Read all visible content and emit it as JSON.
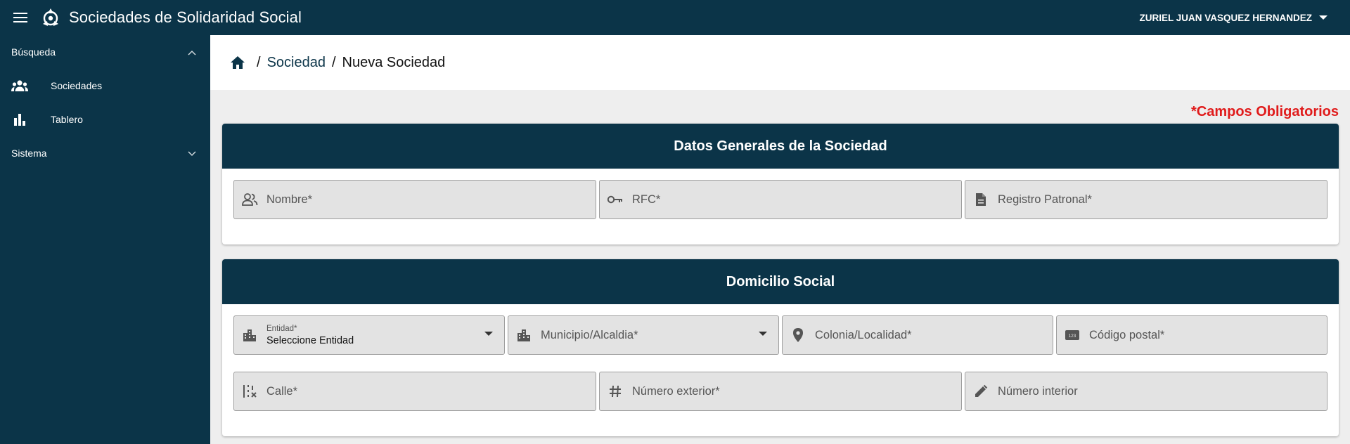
{
  "app": {
    "title": "Sociedades de Solidaridad Social"
  },
  "user": {
    "name": "ZURIEL JUAN VASQUEZ HERNANDEZ"
  },
  "sidebar": {
    "groups": [
      {
        "label": "Búsqueda",
        "expanded": true
      },
      {
        "label": "Sistema",
        "expanded": false
      }
    ],
    "items": [
      {
        "label": "Sociedades",
        "icon": "groups-icon"
      },
      {
        "label": "Tablero",
        "icon": "bar-chart-icon"
      }
    ]
  },
  "breadcrumb": {
    "link": "Sociedad",
    "current": "Nueva Sociedad",
    "separator": "/"
  },
  "required_note": "*Campos Obligatorios",
  "card_general": {
    "title": "Datos Generales de la Sociedad",
    "fields": [
      {
        "placeholder": "Nombre*",
        "icon": "people-outline-icon"
      },
      {
        "placeholder": "RFC*",
        "icon": "key-icon"
      },
      {
        "placeholder": "Registro Patronal*",
        "icon": "document-icon"
      }
    ]
  },
  "card_address": {
    "title": "Domicilio Social",
    "entidad": {
      "label": "Entidad*",
      "value": "Seleccione Entidad",
      "icon": "city-icon"
    },
    "municipio": {
      "placeholder": "Municipio/Alcaldia*",
      "icon": "city-icon"
    },
    "colonia": {
      "placeholder": "Colonia/Localidad*",
      "icon": "location-pin-icon"
    },
    "cp": {
      "placeholder": "Código postal*",
      "icon": "number-123-icon"
    },
    "calle": {
      "placeholder": "Calle*",
      "icon": "road-icon"
    },
    "num_ext": {
      "placeholder": "Número exterior*",
      "icon": "hash-icon"
    },
    "num_int": {
      "placeholder": "Número interior",
      "icon": "pencil-icon"
    }
  },
  "colors": {
    "primary": "#0b3448",
    "required": "#e01b1b",
    "background": "#eeeeee",
    "field_bg": "#e3e3e3"
  }
}
